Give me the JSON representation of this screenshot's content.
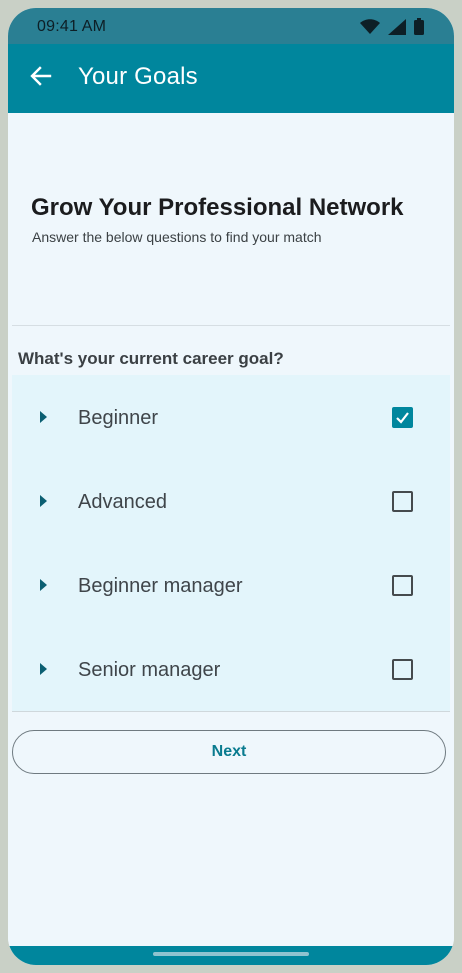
{
  "status_bar": {
    "time": "09:41 AM",
    "icons": [
      "wifi-icon",
      "signal-icon",
      "battery-icon"
    ]
  },
  "app_bar": {
    "back_icon": "arrow-left-icon",
    "title": "Your Goals"
  },
  "header": {
    "title": "Grow Your Professional Network",
    "subtitle": "Answer the below questions to find your match"
  },
  "question": {
    "text": "What's your current career goal?",
    "options": [
      {
        "label": "Beginner",
        "checked": true
      },
      {
        "label": "Advanced",
        "checked": false
      },
      {
        "label": "Beginner manager",
        "checked": false
      },
      {
        "label": "Senior manager",
        "checked": false
      }
    ]
  },
  "actions": {
    "next_label": "Next"
  },
  "colors": {
    "primary": "#00869d",
    "status_bar": "#2a7f93",
    "background": "#eff7fc",
    "options_background": "#e3f5fb"
  }
}
